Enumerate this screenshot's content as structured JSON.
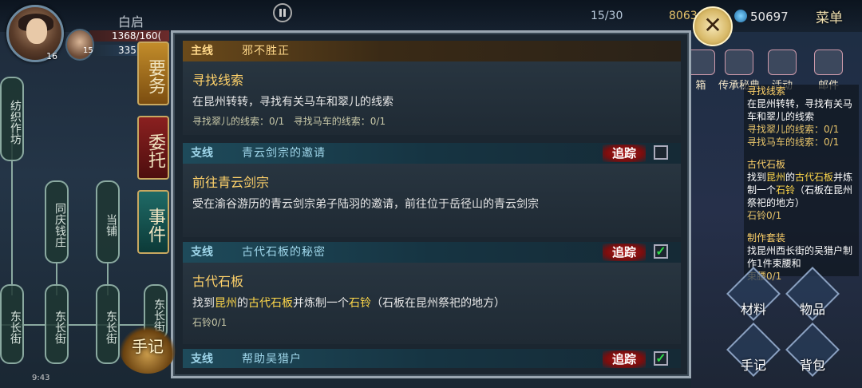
{
  "player": {
    "name": "白启",
    "level": "16",
    "hp": "1368/160(",
    "mp": "335",
    "companion_level": "15"
  },
  "hud": {
    "stamina": "15/30",
    "gold": "8063",
    "coins": "50697",
    "menu": "菜单"
  },
  "left_tree": {
    "nodes": [
      "纺织作坊",
      "同庆钱庄",
      "当铺",
      "东长街",
      "东长街",
      "东长街",
      "东长街"
    ]
  },
  "tabs": [
    "要务",
    "委托",
    "事件"
  ],
  "journal_label": "手记",
  "quests": [
    {
      "type": "主线",
      "title": "邪不胜正",
      "name": "寻找线索",
      "desc": "在昆州转转，寻找有关马车和翠儿的线索",
      "prog1": "寻找翠儿的线索：0/1",
      "prog2": "寻找马车的线索：0/1"
    },
    {
      "type": "支线",
      "title": "青云剑宗的邀请",
      "name": "前往青云剑宗",
      "desc": "受在渝谷游历的青云剑宗弟子陆羽的邀请，前往位于岳径山的青云剑宗",
      "track": "追踪",
      "checked": false
    },
    {
      "type": "支线",
      "title": "古代石板的秘密",
      "name": "古代石板",
      "desc_parts": [
        "找到",
        "昆州",
        "的",
        "古代石板",
        "并炼制一个",
        "石铃",
        "（石板在昆州祭祀的地方）"
      ],
      "prog": "石铃0/1",
      "track": "追踪",
      "checked": true
    },
    {
      "type": "支线",
      "title": "帮助吴猎户",
      "track": "追踪",
      "checked": true
    }
  ],
  "right_icons": [
    "箱",
    "传承秘典",
    "活动",
    "邮件"
  ],
  "tracker": [
    {
      "title": "寻找线索",
      "desc": "在昆州转转，寻找有关马车和翠儿的线索",
      "prog": [
        "寻找翠儿的线索：0/1",
        "寻找马车的线索：0/1"
      ]
    },
    {
      "title": "古代石板",
      "desc_parts": [
        "找到",
        "昆州",
        "的",
        "古代石板",
        "并炼制一个",
        "石铃",
        "（石板在昆州祭祀的地方）"
      ],
      "prog": [
        "石铃0/1"
      ]
    },
    {
      "title": "制作套装",
      "desc": "找昆州西长街的吴猎户制作1件束腰和",
      "prog": [
        "束腰0/1"
      ]
    }
  ],
  "bottom_buttons": [
    "材料",
    "物品",
    "手记",
    "背包"
  ],
  "status_time": "9:43"
}
